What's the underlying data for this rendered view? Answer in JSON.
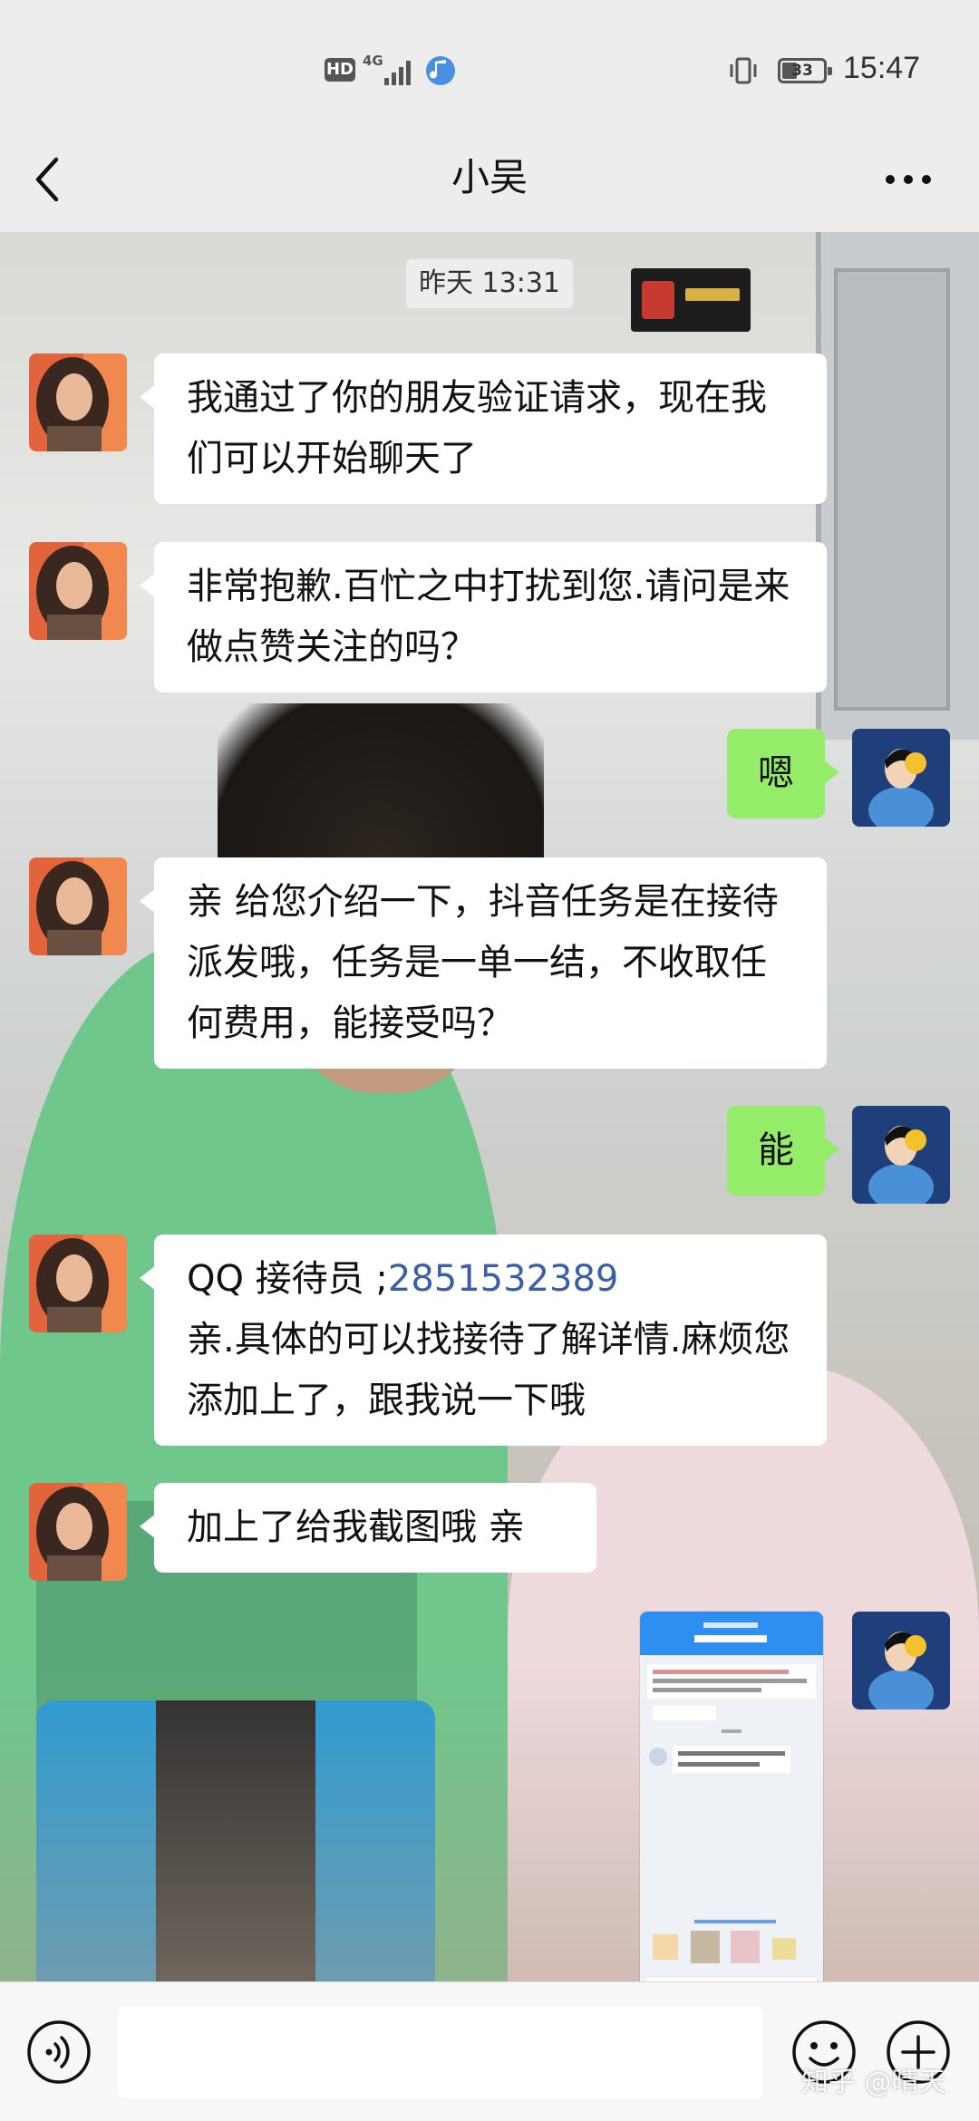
{
  "status_bar": {
    "hd_label": "HD",
    "network_label": "4G",
    "battery_level": "33",
    "time": "15:47"
  },
  "header": {
    "title": "小吴"
  },
  "chat": {
    "timestamp": "昨天 13:31",
    "messages": [
      {
        "side": "left",
        "text": "我通过了你的朋友验证请求，现在我们可以开始聊天了"
      },
      {
        "side": "left",
        "text": "非常抱歉.百忙之中打扰到您.请问是来做点赞关注的吗？"
      },
      {
        "side": "right",
        "text": "嗯"
      },
      {
        "side": "left",
        "text": "亲 给您介绍一下，抖音任务是在接待派发哦，任务是一单一结，不收取任何费用，能接受吗？"
      },
      {
        "side": "right",
        "text": "能"
      },
      {
        "side": "left",
        "qq_label": "QQ 接待员 ;",
        "qq_number": "2851532389",
        "text": "亲.具体的可以找接待了解详情.麻烦您添加上了，跟我说一下哦"
      },
      {
        "side": "left",
        "text": "加上了给我截图哦 亲"
      },
      {
        "side": "right",
        "type": "image",
        "alt": "screenshot"
      }
    ]
  },
  "input_bar": {
    "placeholder": ""
  },
  "watermark": "知乎 @晴天",
  "icons": {
    "back": "chevron-left-icon",
    "more": "more-dots-icon",
    "voice": "voice-icon",
    "emoji": "emoji-icon",
    "plus": "plus-icon"
  },
  "colors": {
    "sent_bubble": "#95ec69",
    "received_bubble": "#ffffff",
    "header_bg": "#ededed",
    "link": "#3a5ea8"
  }
}
